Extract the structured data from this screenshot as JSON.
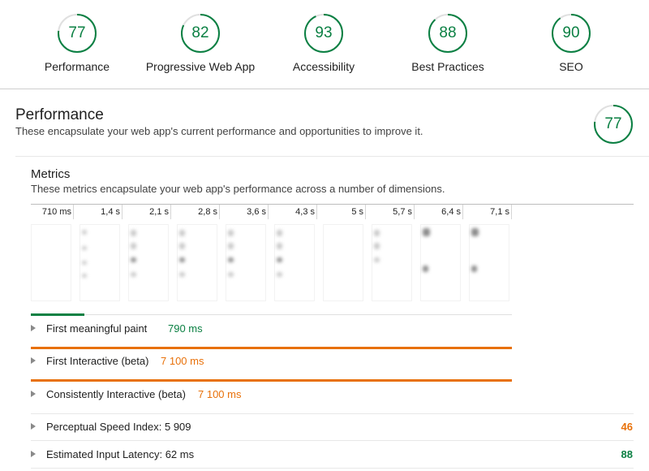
{
  "scores": [
    {
      "value": "77",
      "label": "Performance",
      "fraction": 0.77
    },
    {
      "value": "82",
      "label": "Progressive Web App",
      "fraction": 0.82
    },
    {
      "value": "93",
      "label": "Accessibility",
      "fraction": 0.93
    },
    {
      "value": "88",
      "label": "Best Practices",
      "fraction": 0.88
    },
    {
      "value": "90",
      "label": "SEO",
      "fraction": 0.9
    }
  ],
  "performance": {
    "title": "Performance",
    "description": "These encapsulate your web app's current performance and opportunities to improve it.",
    "score": "77",
    "score_fraction": 0.77
  },
  "metrics": {
    "title": "Metrics",
    "description": "These metrics encapsulate your web app's performance across a number of dimensions.",
    "frames": [
      "710 ms",
      "1,4 s",
      "2,1 s",
      "2,8 s",
      "3,6 s",
      "4,3 s",
      "5 s",
      "5,7 s",
      "6,4 s",
      "7,1 s"
    ],
    "rows": [
      {
        "label": "First meaningful paint",
        "value": "790 ms",
        "status": "green"
      },
      {
        "label": "First Interactive (beta)",
        "value": "7 100 ms",
        "status": "orange"
      },
      {
        "label": "Consistently Interactive (beta)",
        "value": "7 100 ms",
        "status": "orange"
      }
    ],
    "extra_rows": [
      {
        "label": "Perceptual Speed Index: 5 909",
        "score": "46",
        "status": "orange"
      },
      {
        "label": "Estimated Input Latency: 62 ms",
        "score": "88",
        "status": "green"
      }
    ]
  },
  "colors": {
    "pass": "#0b8043",
    "average": "#e8710a",
    "gauge_track": "#e0e0e0"
  }
}
